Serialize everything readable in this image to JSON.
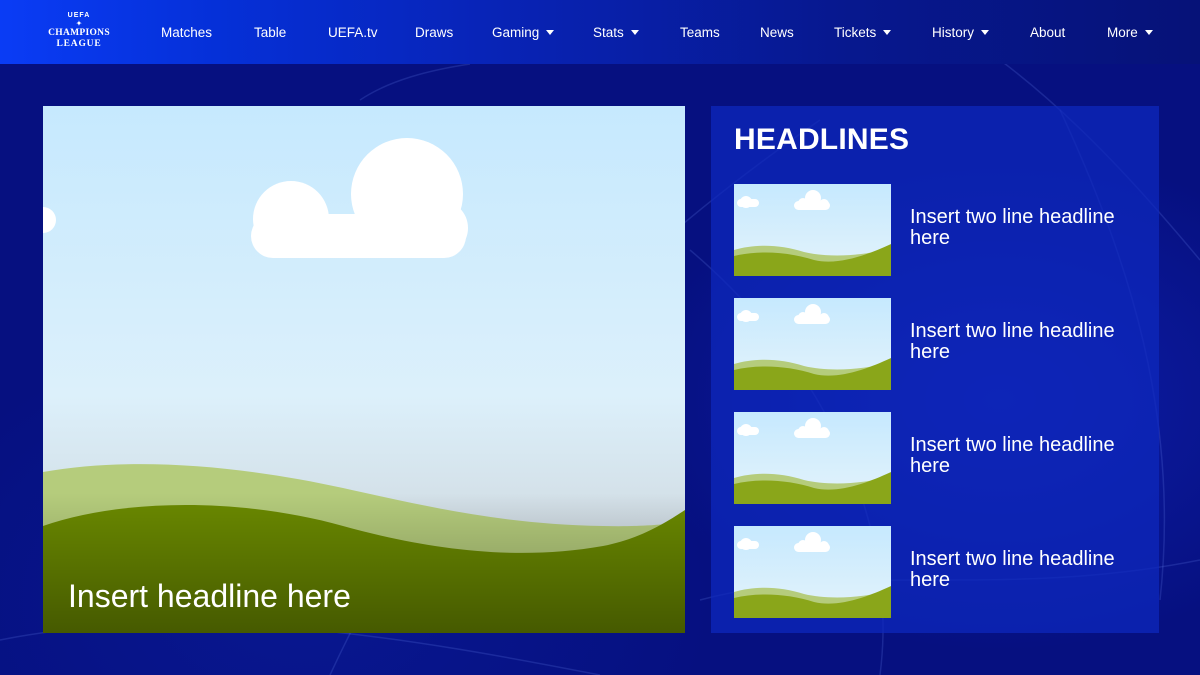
{
  "logo": {
    "org": "UEFA",
    "line1": "CHAMPIONS",
    "line2": "LEAGUE"
  },
  "nav": {
    "items": [
      {
        "label": "Matches",
        "dropdown": false
      },
      {
        "label": "Table",
        "dropdown": false
      },
      {
        "label": "UEFA.tv",
        "dropdown": false
      },
      {
        "label": "Draws",
        "dropdown": false
      },
      {
        "label": "Gaming",
        "dropdown": true
      },
      {
        "label": "Stats",
        "dropdown": true
      },
      {
        "label": "Teams",
        "dropdown": false
      },
      {
        "label": "News",
        "dropdown": false
      },
      {
        "label": "Tickets",
        "dropdown": true
      },
      {
        "label": "History",
        "dropdown": true
      },
      {
        "label": "About",
        "dropdown": false
      },
      {
        "label": "More",
        "dropdown": true
      }
    ]
  },
  "hero": {
    "image_icon": "landscape-placeholder-icon",
    "headline": "Insert headline here"
  },
  "headlines": {
    "title": "HEADLINES",
    "items": [
      {
        "text": "Insert two line headline here",
        "image_icon": "landscape-thumbnail-icon"
      },
      {
        "text": "Insert two line headline here",
        "image_icon": "landscape-thumbnail-icon"
      },
      {
        "text": "Insert two line headline here",
        "image_icon": "landscape-thumbnail-icon"
      },
      {
        "text": "Insert two line headline here",
        "image_icon": "landscape-thumbnail-icon"
      }
    ]
  },
  "colors": {
    "background": "#061080",
    "nav_start": "#0a3cf5",
    "nav_end": "#061278",
    "panel": "#0e28be",
    "text": "#ffffff",
    "grass_dark": "#6b8a00",
    "grass_light": "#b5cc7c"
  }
}
